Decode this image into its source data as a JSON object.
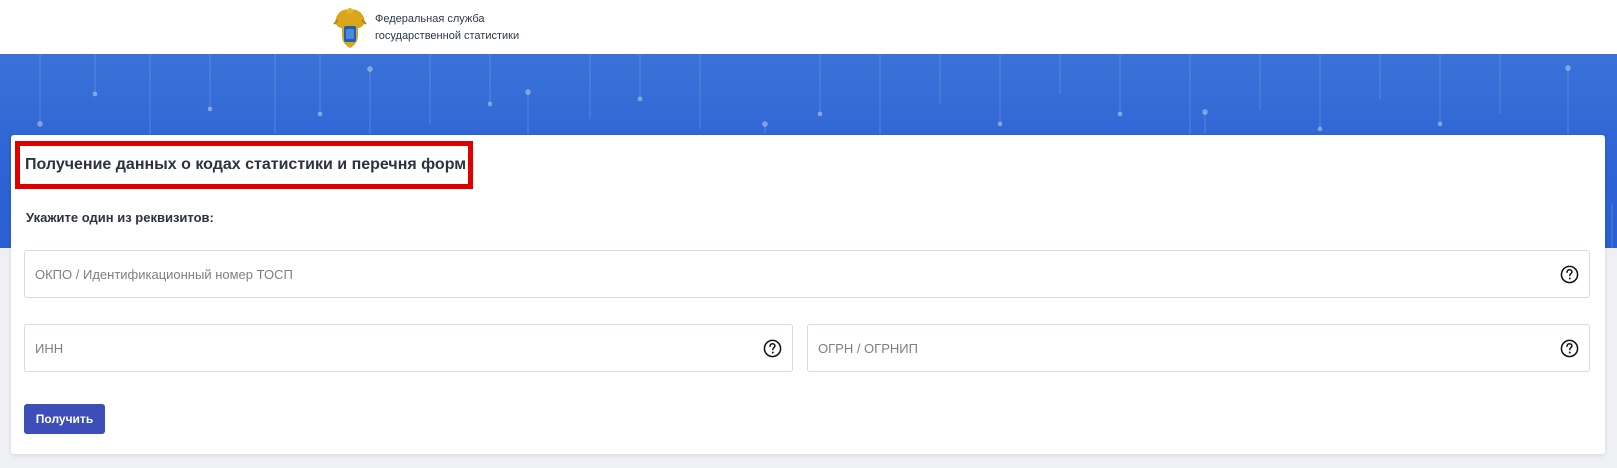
{
  "header": {
    "org_name_line1": "Федеральная служба",
    "org_name_line2": "государственной статистики",
    "logo_icon": "coat-of-arms-icon"
  },
  "form": {
    "title": "Получение данных о кодах статистики и перечня форм",
    "subtitle": "Укажите один из реквизитов:",
    "fields": {
      "okpo": {
        "placeholder": "ОКПО / Идентификационный номер ТОСП",
        "value": "",
        "icon": "help-icon"
      },
      "inn": {
        "placeholder": "ИНН",
        "value": "",
        "icon": "help-icon"
      },
      "ogrn": {
        "placeholder": "ОГРН / ОГРНИП",
        "value": "",
        "icon": "help-icon"
      }
    },
    "submit_label": "Получить"
  },
  "colors": {
    "banner": "#2d63d4",
    "button": "#3d4eb8",
    "highlight_border": "#e00000"
  }
}
